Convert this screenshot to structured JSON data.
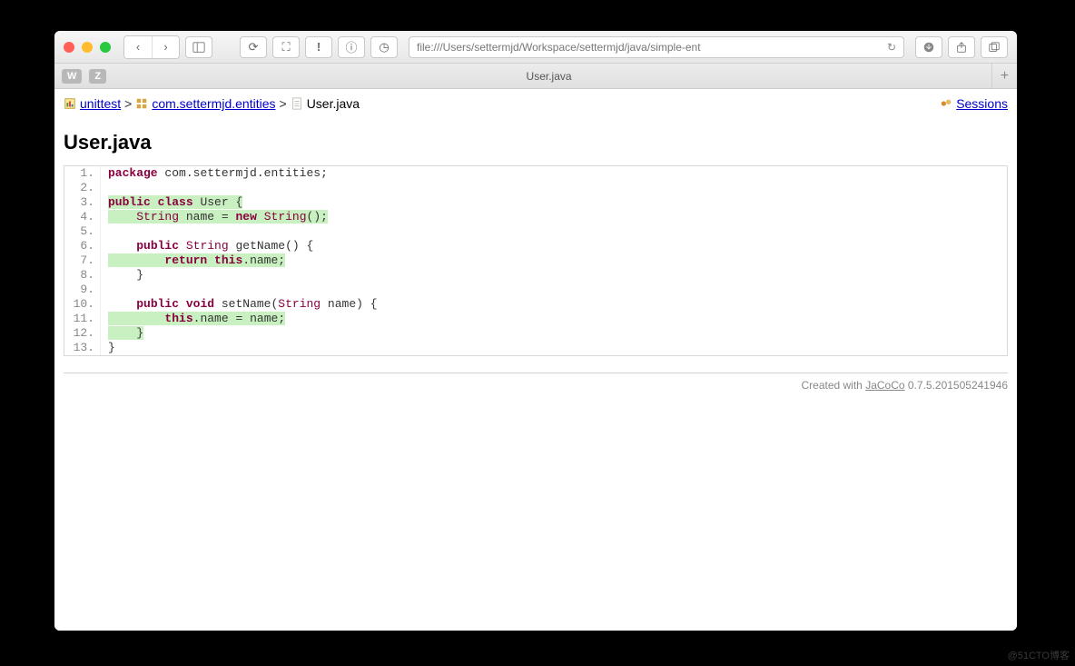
{
  "browser": {
    "url": "file:///Users/settermjd/Workspace/settermjd/java/simple-ent",
    "pills": [
      "W",
      "Z"
    ],
    "tab_title": "User.java"
  },
  "breadcrumbs": {
    "root": "unittest",
    "pkg": "com.settermjd.entities",
    "file": "User.java",
    "sep": ">",
    "sessions": "Sessions"
  },
  "page": {
    "title": "User.java"
  },
  "code": {
    "lines": [
      {
        "n": "1.",
        "cov": false,
        "tokens": [
          [
            "kw",
            "package"
          ],
          [
            "",
            ""
          ],
          [
            "ident",
            " com"
          ],
          [
            "punct",
            "."
          ],
          [
            "ident",
            "settermjd"
          ],
          [
            "punct",
            "."
          ],
          [
            "ident",
            "entities"
          ],
          [
            "punct",
            ";"
          ]
        ]
      },
      {
        "n": "2.",
        "cov": false,
        "tokens": []
      },
      {
        "n": "3.",
        "cov": true,
        "tokens": [
          [
            "kw",
            "public"
          ],
          [
            "",
            " "
          ],
          [
            "kw",
            "class"
          ],
          [
            "",
            " "
          ],
          [
            "ident",
            "User"
          ],
          [
            "",
            " "
          ],
          [
            "punct",
            "{"
          ]
        ]
      },
      {
        "n": "4.",
        "cov": true,
        "tokens": [
          [
            "",
            "    "
          ],
          [
            "type",
            "String"
          ],
          [
            "",
            " "
          ],
          [
            "ident",
            "name"
          ],
          [
            "",
            " "
          ],
          [
            "punct",
            "="
          ],
          [
            "",
            " "
          ],
          [
            "kw",
            "new"
          ],
          [
            "",
            " "
          ],
          [
            "type",
            "String"
          ],
          [
            "punct",
            "();"
          ]
        ]
      },
      {
        "n": "5.",
        "cov": false,
        "tokens": []
      },
      {
        "n": "6.",
        "cov": false,
        "tokens": [
          [
            "",
            "    "
          ],
          [
            "kw",
            "public"
          ],
          [
            "",
            " "
          ],
          [
            "type",
            "String"
          ],
          [
            "",
            " "
          ],
          [
            "ident",
            "getName"
          ],
          [
            "punct",
            "()"
          ],
          [
            "",
            " "
          ],
          [
            "punct",
            "{"
          ]
        ]
      },
      {
        "n": "7.",
        "cov": true,
        "tokens": [
          [
            "",
            "        "
          ],
          [
            "kw",
            "return"
          ],
          [
            "",
            " "
          ],
          [
            "kw",
            "this"
          ],
          [
            "punct",
            "."
          ],
          [
            "ident",
            "name"
          ],
          [
            "punct",
            ";"
          ]
        ]
      },
      {
        "n": "8.",
        "cov": false,
        "tokens": [
          [
            "",
            "    "
          ],
          [
            "punct",
            "}"
          ]
        ]
      },
      {
        "n": "9.",
        "cov": false,
        "tokens": []
      },
      {
        "n": "10.",
        "cov": false,
        "tokens": [
          [
            "",
            "    "
          ],
          [
            "kw",
            "public"
          ],
          [
            "",
            " "
          ],
          [
            "kw",
            "void"
          ],
          [
            "",
            " "
          ],
          [
            "ident",
            "setName"
          ],
          [
            "punct",
            "("
          ],
          [
            "type",
            "String"
          ],
          [
            "",
            " "
          ],
          [
            "ident",
            "name"
          ],
          [
            "punct",
            ")"
          ],
          [
            "",
            " "
          ],
          [
            "punct",
            "{"
          ]
        ]
      },
      {
        "n": "11.",
        "cov": true,
        "tokens": [
          [
            "",
            "        "
          ],
          [
            "kw",
            "this"
          ],
          [
            "punct",
            "."
          ],
          [
            "ident",
            "name"
          ],
          [
            "",
            " "
          ],
          [
            "punct",
            "="
          ],
          [
            "",
            " "
          ],
          [
            "ident",
            "name"
          ],
          [
            "punct",
            ";"
          ]
        ]
      },
      {
        "n": "12.",
        "cov": true,
        "tokens": [
          [
            "",
            "    "
          ],
          [
            "punct",
            "}"
          ]
        ]
      },
      {
        "n": "13.",
        "cov": false,
        "tokens": [
          [
            "punct",
            "}"
          ]
        ]
      }
    ]
  },
  "footer": {
    "prefix": "Created with ",
    "link": "JaCoCo",
    "version": " 0.7.5.201505241946"
  },
  "watermark": "@51CTO博客"
}
